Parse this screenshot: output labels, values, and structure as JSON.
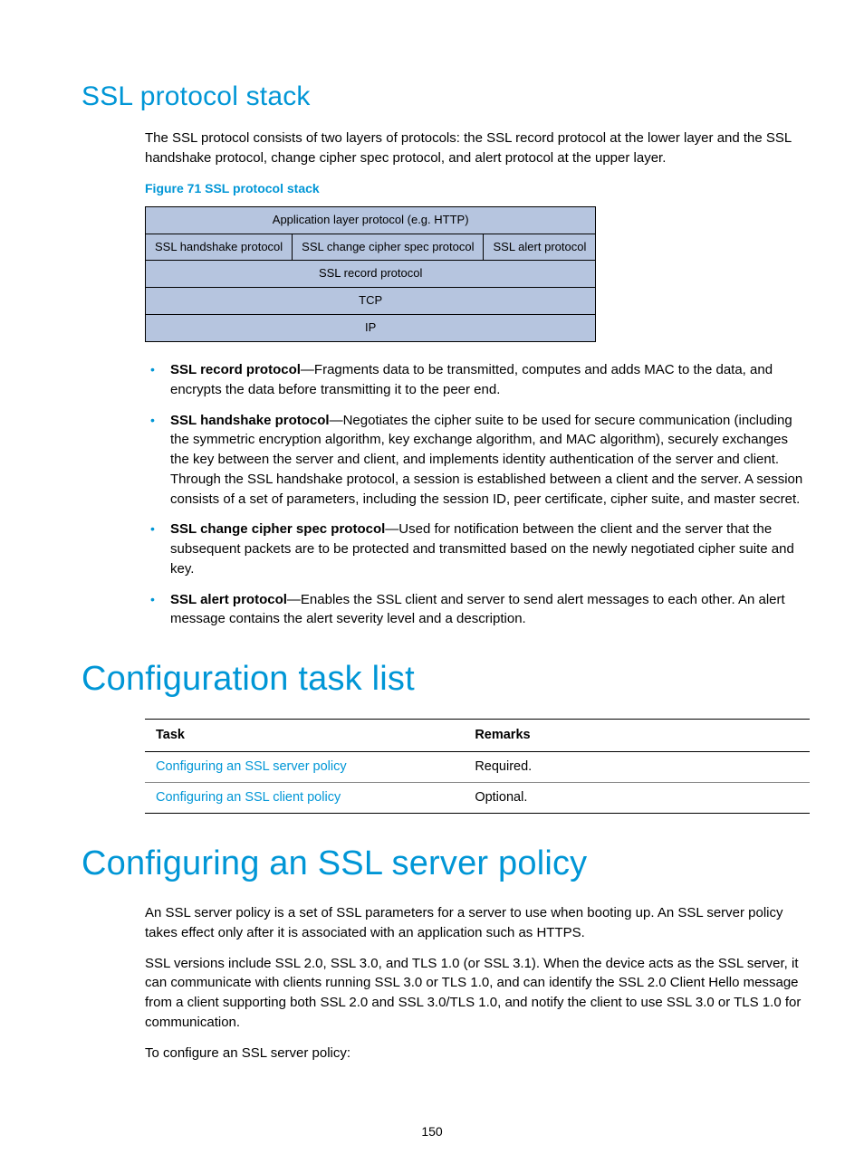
{
  "section1": {
    "title": "SSL protocol stack",
    "intro": "The SSL protocol consists of two layers of protocols: the SSL record protocol at the lower layer and the SSL handshake protocol, change cipher spec protocol, and alert protocol at the upper layer.",
    "figure_caption": "Figure 71 SSL protocol stack",
    "stack": {
      "row1": "Application layer protocol (e.g. HTTP)",
      "row2": {
        "a": "SSL handshake protocol",
        "b": "SSL change cipher spec protocol",
        "c": "SSL alert protocol"
      },
      "row3": "SSL record protocol",
      "row4": "TCP",
      "row5": "IP"
    },
    "bullets": [
      {
        "term": "SSL record protocol",
        "desc": "—Fragments data to be transmitted, computes and adds MAC to the data, and encrypts the data before transmitting it to the peer end."
      },
      {
        "term": "SSL handshake protocol",
        "desc": "—Negotiates the cipher suite to be used for secure communication (including the symmetric encryption algorithm, key exchange algorithm, and MAC algorithm), securely exchanges the key between the server and client, and implements identity authentication of the server and client. Through the SSL handshake protocol, a session is established between a client and the server. A session consists of a set of parameters, including the session ID, peer certificate, cipher suite, and master secret."
      },
      {
        "term": "SSL change cipher spec protocol",
        "desc": "—Used for notification between the client and the server that the subsequent packets are to be protected and transmitted based on the newly negotiated cipher suite and key."
      },
      {
        "term": "SSL alert protocol",
        "desc": "—Enables the SSL client and server to send alert messages to each other. An alert message contains the alert severity level and a description."
      }
    ]
  },
  "section2": {
    "title": "Configuration task list",
    "table": {
      "head": {
        "task": "Task",
        "remarks": "Remarks"
      },
      "rows": [
        {
          "task": "Configuring an SSL server policy",
          "remarks": "Required."
        },
        {
          "task": "Configuring an SSL client policy",
          "remarks": "Optional."
        }
      ]
    }
  },
  "section3": {
    "title": "Configuring an SSL server policy",
    "p1": "An SSL server policy is a set of SSL parameters for a server to use when booting up. An SSL server policy takes effect only after it is associated with an application such as HTTPS.",
    "p2": "SSL versions include SSL 2.0, SSL 3.0, and TLS 1.0 (or SSL 3.1). When the device acts as the SSL server, it can communicate with clients running SSL 3.0 or TLS 1.0, and can identify the SSL 2.0 Client Hello message from a client supporting both SSL 2.0 and SSL 3.0/TLS 1.0, and notify the client to use SSL 3.0 or TLS 1.0 for communication.",
    "p3": "To configure an SSL server policy:"
  },
  "page_number": "150"
}
